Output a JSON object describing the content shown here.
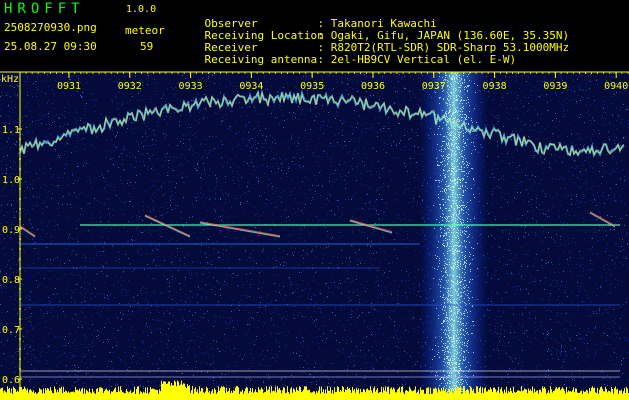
{
  "app": {
    "title": "HROFFT",
    "version": "1.0.0"
  },
  "file": {
    "name": "2508270930.png",
    "datetime": "25.08.27 09:30"
  },
  "detection": {
    "label": "meteor",
    "count": "59"
  },
  "info": [
    {
      "label": "Observer",
      "value": ": Takanori Kawachi"
    },
    {
      "label": "Receiving Location",
      "value": ": Ogaki, Gifu, JAPAN (136.60E, 35.35N)"
    },
    {
      "label": "Receiver",
      "value": ": R820T2(RTL-SDR) SDR-Sharp 53.1000MHz"
    },
    {
      "label": "Receiving antenna",
      "value": ": 2el-HB9CV Vertical (el. E-W)"
    }
  ],
  "axis": {
    "y_unit": "kHz",
    "y_ticks": [
      "1.1",
      "1.0",
      "0.9",
      "0.8",
      "0.7",
      "0.6"
    ],
    "x_ticks": [
      "0931",
      "0932",
      "0933",
      "0934",
      "0935",
      "0936",
      "0937",
      "0938",
      "0939",
      "0940"
    ]
  },
  "colors": {
    "background": "#000000",
    "text": "#ffff00",
    "title": "#00ff00",
    "noise": "#0a1a8c",
    "signal": "#7fffd4"
  }
}
